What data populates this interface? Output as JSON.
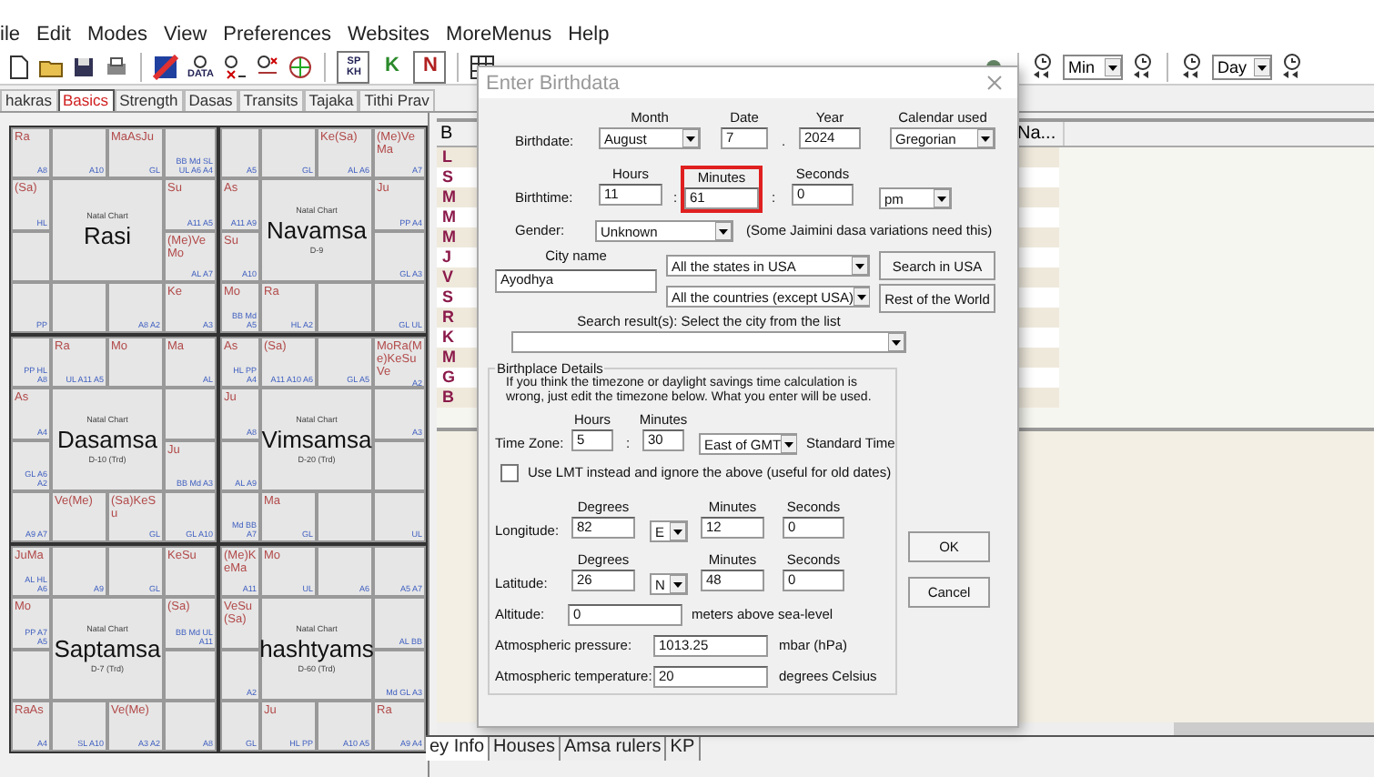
{
  "menu": [
    "ile",
    "Edit",
    "Modes",
    "View",
    "Preferences",
    "Websites",
    "MoreMenus",
    "Help"
  ],
  "toolbar": {
    "data_label": "DATA",
    "sp_label": "SP",
    "kh_label": "KH",
    "k_label": "K",
    "n_label": "N",
    "step_unit": "Min",
    "date_unit": "Day"
  },
  "tabs": [
    {
      "label": "hakras",
      "selected": false
    },
    {
      "label": "Basics",
      "selected": true
    },
    {
      "label": "Strength",
      "selected": false
    },
    {
      "label": "Dasas",
      "selected": false
    },
    {
      "label": "Transits",
      "selected": false
    },
    {
      "label": "Tajaka",
      "selected": false
    },
    {
      "label": "Tithi Prav",
      "selected": false
    }
  ],
  "charts": [
    {
      "heading": "Natal Chart",
      "name": "Rasi",
      "cells": [
        {
          "planets": "Ra",
          "notes": "A8"
        },
        {
          "notes": "A10"
        },
        {
          "planets": "MaAsJu",
          "notes": "GL"
        },
        {
          "notes": "BB Md SL UL A6 A4"
        },
        {
          "planets": "(Sa)",
          "notes": "HL"
        },
        {
          "planets": "Su",
          "notes": "A11 A5"
        },
        {},
        {
          "planets": "(Me)VeMo",
          "notes": "AL A7"
        },
        {
          "notes": "PP"
        },
        {},
        {
          "notes": "A8 A2"
        },
        {
          "planets": "Ke",
          "notes": "A3"
        }
      ]
    },
    {
      "heading": "Natal Chart",
      "name": "Navamsa",
      "subtitle": "D-9",
      "cells": [
        {
          "notes": "A5"
        },
        {
          "notes": "GL"
        },
        {
          "planets": "Ke(Sa)",
          "notes": "AL A6"
        },
        {
          "planets": "(Me)VeMa",
          "notes": "A7"
        },
        {
          "planets": "As",
          "notes": "A11 A9"
        },
        {
          "planets": "Ju",
          "notes": "PP A4"
        },
        {
          "planets": "Su",
          "notes": "A10"
        },
        {
          "notes": "GL A3"
        },
        {
          "planets": "Mo",
          "notes": "BB Md A5"
        },
        {
          "planets": "Ra",
          "notes": "HL A2"
        },
        {},
        {
          "notes": "GL UL"
        }
      ]
    },
    {
      "heading": "Natal Chart",
      "name": "Dasamsa",
      "subtitle": "D-10 (Trd)",
      "cells": [
        {
          "notes": "PP HL A8"
        },
        {
          "planets": "Ra",
          "notes": "UL A11 A5"
        },
        {
          "planets": "Mo"
        },
        {
          "planets": "Ma",
          "notes": "AL"
        },
        {
          "planets": "As",
          "notes": "A4"
        },
        {},
        {
          "notes": "GL A6 A2"
        },
        {
          "planets": "Ju",
          "notes": "BB Md A3"
        },
        {
          "notes": "A9 A7"
        },
        {
          "planets": "Ve(Me)"
        },
        {
          "planets": "(Sa)KeSu",
          "notes": "GL"
        },
        {
          "notes": "GL A10"
        }
      ]
    },
    {
      "heading": "Natal Chart",
      "name": "Vimsamsa",
      "subtitle": "D-20 (Trd)",
      "cells": [
        {
          "planets": "As",
          "notes": "HL PP A4"
        },
        {
          "planets": "(Sa)",
          "notes": "A11 A10 A6"
        },
        {
          "notes": "GL A5"
        },
        {
          "planets": "MoRa(Me)KeSuVe",
          "notes": "A2"
        },
        {
          "planets": "Ju",
          "notes": "A8"
        },
        {
          "notes": "A3"
        },
        {
          "notes": "AL A9"
        },
        {},
        {
          "notes": "Md BB A7"
        },
        {
          "planets": "Ma",
          "notes": "GL"
        },
        {},
        {
          "notes": "UL"
        }
      ]
    },
    {
      "heading": "Natal Chart",
      "name": "Saptamsa",
      "subtitle": "D-7 (Trd)",
      "cells": [
        {
          "planets": "JuMa",
          "notes": "AL HL A6"
        },
        {
          "notes": "A9"
        },
        {
          "notes": "GL"
        },
        {
          "planets": "KeSu"
        },
        {
          "planets": "Mo",
          "notes": "PP A7 A5"
        },
        {
          "planets": "(Sa)",
          "notes": "BB Md UL A11"
        },
        {},
        {},
        {
          "planets": "RaAs",
          "notes": "A4"
        },
        {
          "notes": "SL A10"
        },
        {
          "planets": "Ve(Me)",
          "notes": "A3 A2"
        },
        {
          "notes": "A8"
        }
      ]
    },
    {
      "heading": "Natal Chart",
      "name": "hashtyams",
      "subtitle": "D-60 (Trd)",
      "cells": [
        {
          "planets": "(Me)KeMa",
          "notes": "A11"
        },
        {
          "planets": "Mo",
          "notes": "UL"
        },
        {
          "notes": "A6"
        },
        {
          "notes": "A5 A7"
        },
        {
          "planets": "VeSu(Sa)"
        },
        {
          "notes": "AL BB"
        },
        {
          "notes": "A2"
        },
        {
          "notes": "Md GL A3"
        },
        {
          "notes": "GL"
        },
        {
          "planets": "Ju",
          "notes": "HL PP"
        },
        {
          "notes": "A10 A5"
        },
        {
          "planets": "Ra",
          "notes": "A9 A4"
        }
      ]
    }
  ],
  "table": {
    "columns": [
      "B",
      "Na..."
    ],
    "rows": [
      "L",
      "S",
      "M",
      "M",
      "M",
      "J",
      "V",
      "S",
      "R",
      "K",
      "M",
      "G",
      "B"
    ]
  },
  "bottom_tabs": [
    {
      "label": "ey Info",
      "selected": true
    },
    {
      "label": "Houses",
      "selected": false
    },
    {
      "label": "Amsa rulers",
      "selected": false
    },
    {
      "label": "KP",
      "selected": false
    }
  ],
  "dialog": {
    "title": "Enter Birthdata",
    "birthdate": {
      "label": "Birthdate:",
      "month": {
        "caption": "Month",
        "value": "August"
      },
      "date": {
        "caption": "Date",
        "value": "7"
      },
      "separator": ".",
      "year": {
        "caption": "Year",
        "value": "2024"
      },
      "calendar": {
        "caption": "Calendar used",
        "value": "Gregorian"
      }
    },
    "birthtime": {
      "label": "Birthtime:",
      "hours": {
        "caption": "Hours",
        "value": "11",
        "highlighted": false
      },
      "minutes": {
        "caption": "Minutes",
        "value": "61",
        "highlighted": true
      },
      "seconds": {
        "caption": "Seconds",
        "value": "0",
        "highlighted": false
      },
      "separators": [
        ":",
        ":"
      ],
      "meridiem": "pm"
    },
    "gender": {
      "label": "Gender:",
      "value": "Unknown",
      "note": "(Some Jaimini dasa variations need this)"
    },
    "city": {
      "caption": "City name",
      "value": "Ayodhya",
      "state": "All the states in USA",
      "country": "All the countries (except USA)",
      "buttons": [
        "Search in USA",
        "Rest of the World"
      ]
    },
    "search_result": {
      "caption": "Search result(s): Select the city from the list"
    },
    "birthplace": {
      "legend": "Birthplace Details",
      "info": "If you think the timezone or daylight savings time calculation is wrong, just edit the timezone below. What you enter will be used.",
      "timezone": {
        "label": "Time Zone:",
        "hours": {
          "caption": "Hours",
          "value": "5"
        },
        "separator": ":",
        "minutes": {
          "caption": "Minutes",
          "value": "30"
        },
        "direction": "East of GMT",
        "note": "Standard Time"
      },
      "lmt": {
        "label": "Use LMT instead and ignore the above (useful for old dates)",
        "checked": false
      },
      "longitude": {
        "label": "Longitude:",
        "degrees": {
          "caption": "Degrees",
          "value": "82"
        },
        "direction": "E",
        "minutes": {
          "caption": "Minutes",
          "value": "12"
        },
        "seconds": {
          "caption": "Seconds",
          "value": "0"
        }
      },
      "latitude": {
        "label": "Latitude:",
        "degrees": {
          "caption": "Degrees",
          "value": "26"
        },
        "direction": "N",
        "minutes": {
          "caption": "Minutes",
          "value": "48"
        },
        "seconds": {
          "caption": "Seconds",
          "value": "0"
        }
      },
      "altitude": {
        "label": "Altitude:",
        "value": "0",
        "unit": "meters above sea-level"
      },
      "pressure": {
        "label": "Atmospheric pressure:",
        "value": "1013.25",
        "unit": "mbar (hPa)"
      },
      "temperature": {
        "label": "Atmospheric temperature:",
        "value": "20",
        "unit": "degrees Celsius"
      }
    },
    "buttons": [
      "OK",
      "Cancel"
    ]
  }
}
